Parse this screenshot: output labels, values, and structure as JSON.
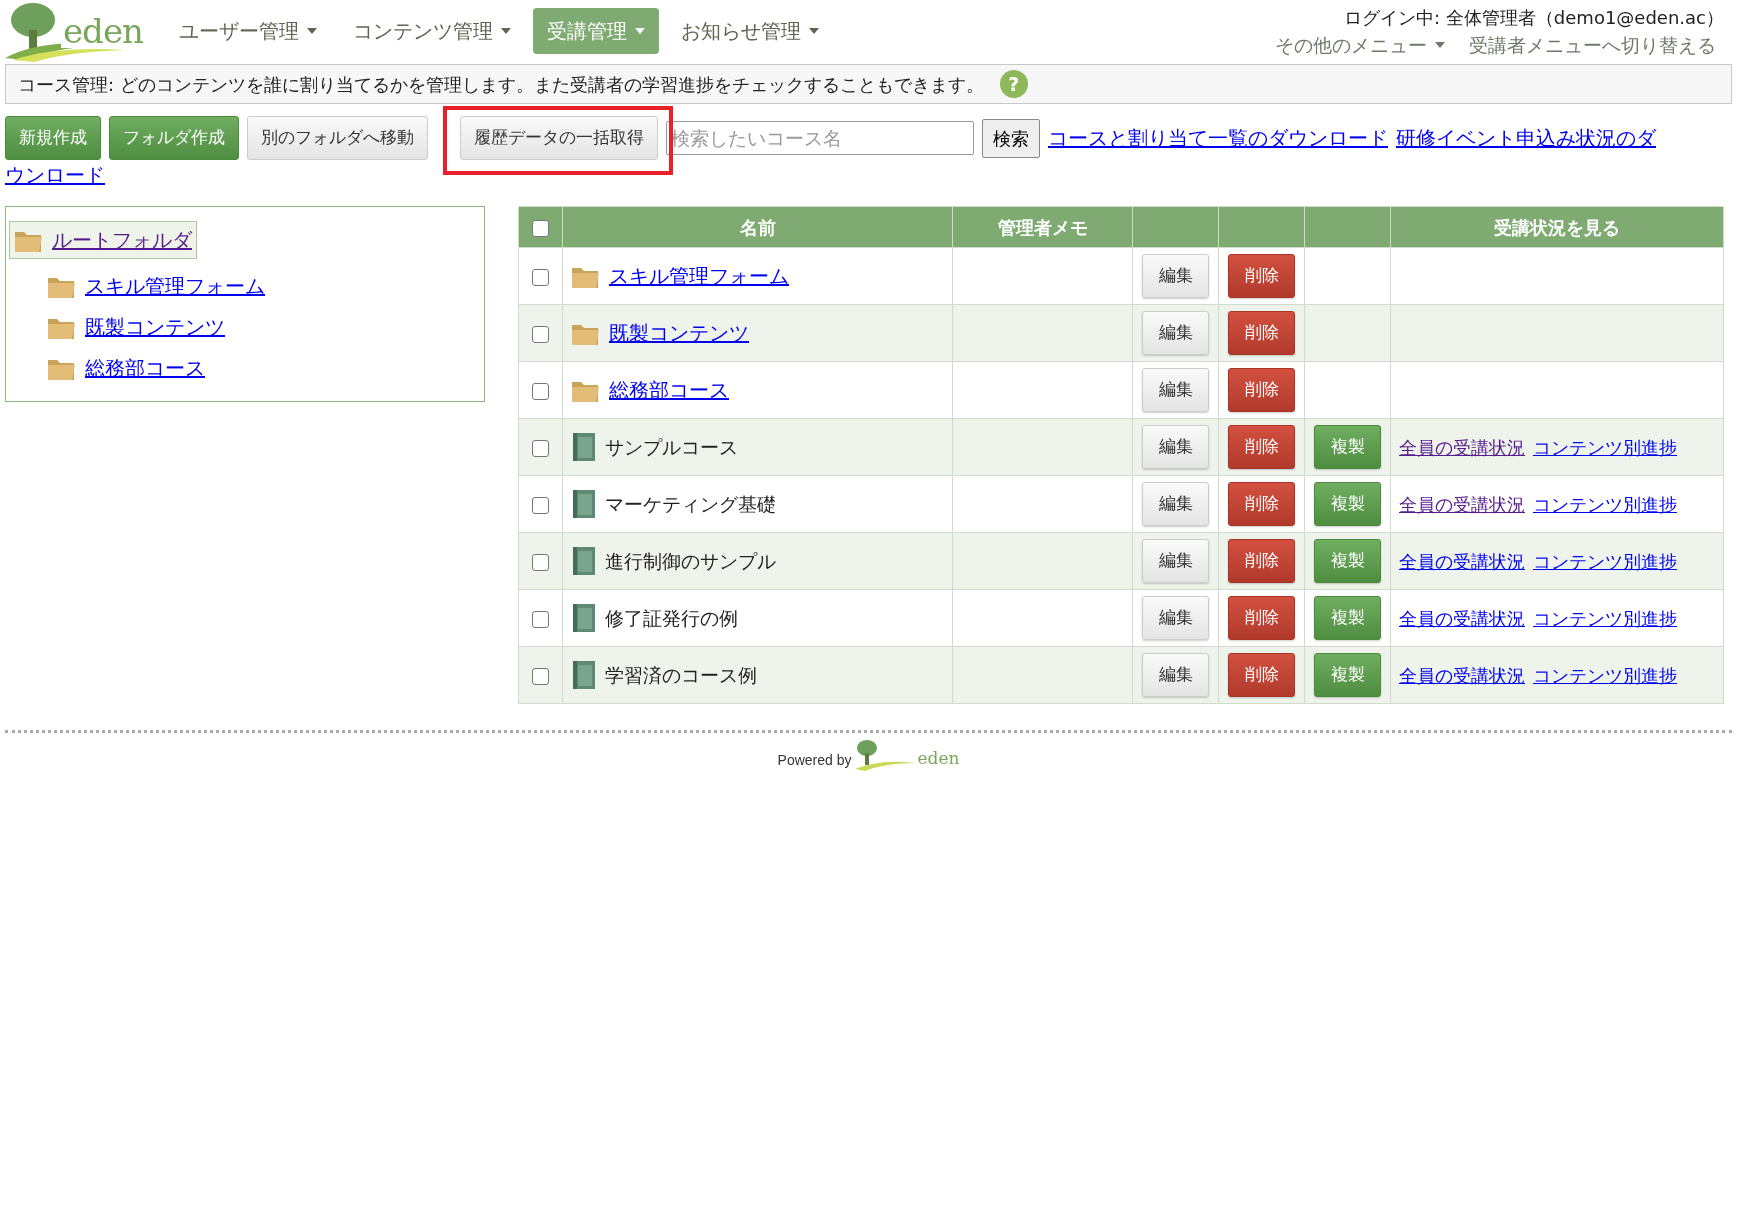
{
  "logo": {
    "text": "eden"
  },
  "nav": [
    {
      "label": "ユーザー管理",
      "selected": false
    },
    {
      "label": "コンテンツ管理",
      "selected": false
    },
    {
      "label": "受講管理",
      "selected": true
    },
    {
      "label": "お知らせ管理",
      "selected": false
    }
  ],
  "login": "ログイン中: 全体管理者（demo1@eden.ac）",
  "sub_menu": [
    {
      "label": "その他のメニュー",
      "dropdown": true
    },
    {
      "label": "受講者メニューへ切り替える",
      "dropdown": false
    }
  ],
  "info": {
    "text": "コース管理: どのコンテンツを誰に割り当てるかを管理します。また受講者の学習進捗をチェックすることもできます。",
    "help": "?"
  },
  "toolbar": {
    "buttons": [
      {
        "label": "新規作成",
        "kind": "primary",
        "highlighted": false
      },
      {
        "label": "フォルダ作成",
        "kind": "primary",
        "highlighted": false
      },
      {
        "label": "別のフォルダへ移動",
        "kind": "default",
        "highlighted": false
      },
      {
        "label": "履歴データの一括取得",
        "kind": "default",
        "highlighted": true
      }
    ],
    "search": {
      "placeholder": "検索したいコース名",
      "button": "検索"
    },
    "links": [
      {
        "lines": [
          "コースと割り当て一覧のダウンロード"
        ]
      },
      {
        "lines": [
          "研修イベント申込み状況のダ",
          "ウンロード"
        ]
      }
    ]
  },
  "tree": {
    "label": "ルートフォルダ",
    "selected": true,
    "visited": true,
    "children": [
      {
        "label": "スキル管理フォーム",
        "selected": false,
        "visited": false
      },
      {
        "label": "既製コンテンツ",
        "selected": false,
        "visited": false
      },
      {
        "label": "総務部コース",
        "selected": false,
        "visited": false
      }
    ]
  },
  "table": {
    "select_all": false,
    "columns": {
      "name": "名前",
      "memo": "管理者メモ",
      "status": "受講状況を見る"
    },
    "rows": [
      {
        "kind": "folder",
        "checked": false,
        "name": "スキル管理フォーム",
        "edit": "編集",
        "delete": "削除"
      },
      {
        "kind": "folder",
        "checked": false,
        "name": "既製コンテンツ",
        "edit": "編集",
        "delete": "削除"
      },
      {
        "kind": "folder",
        "checked": false,
        "name": "総務部コース",
        "edit": "編集",
        "delete": "削除"
      },
      {
        "kind": "course",
        "checked": false,
        "name": "サンプルコース",
        "edit": "編集",
        "delete": "削除",
        "copy": "複製",
        "status_links": [
          {
            "text": "全員の受講状況",
            "visited": true
          },
          {
            "text": "コンテンツ別進捗",
            "visited": false
          }
        ]
      },
      {
        "kind": "course",
        "checked": false,
        "name": "マーケティング基礎",
        "edit": "編集",
        "delete": "削除",
        "copy": "複製",
        "status_links": [
          {
            "text": "全員の受講状況",
            "visited": true
          },
          {
            "text": "コンテンツ別進捗",
            "visited": false
          }
        ]
      },
      {
        "kind": "course",
        "checked": false,
        "name": "進行制御のサンプル",
        "edit": "編集",
        "delete": "削除",
        "copy": "複製",
        "status_links": [
          {
            "text": "全員の受講状況",
            "visited": false
          },
          {
            "text": "コンテンツ別進捗",
            "visited": false
          }
        ]
      },
      {
        "kind": "course",
        "checked": false,
        "name": "修了証発行の例",
        "edit": "編集",
        "delete": "削除",
        "copy": "複製",
        "status_links": [
          {
            "text": "全員の受講状況",
            "visited": false
          },
          {
            "text": "コンテンツ別進捗",
            "visited": false
          }
        ]
      },
      {
        "kind": "course",
        "checked": false,
        "name": "学習済のコース例",
        "edit": "編集",
        "delete": "削除",
        "copy": "複製",
        "status_links": [
          {
            "text": "全員の受講状況",
            "visited": false
          },
          {
            "text": "コンテンツ別進捗",
            "visited": false
          }
        ]
      }
    ]
  },
  "footer": {
    "powered_by": "Powered by",
    "logo": "eden"
  }
}
